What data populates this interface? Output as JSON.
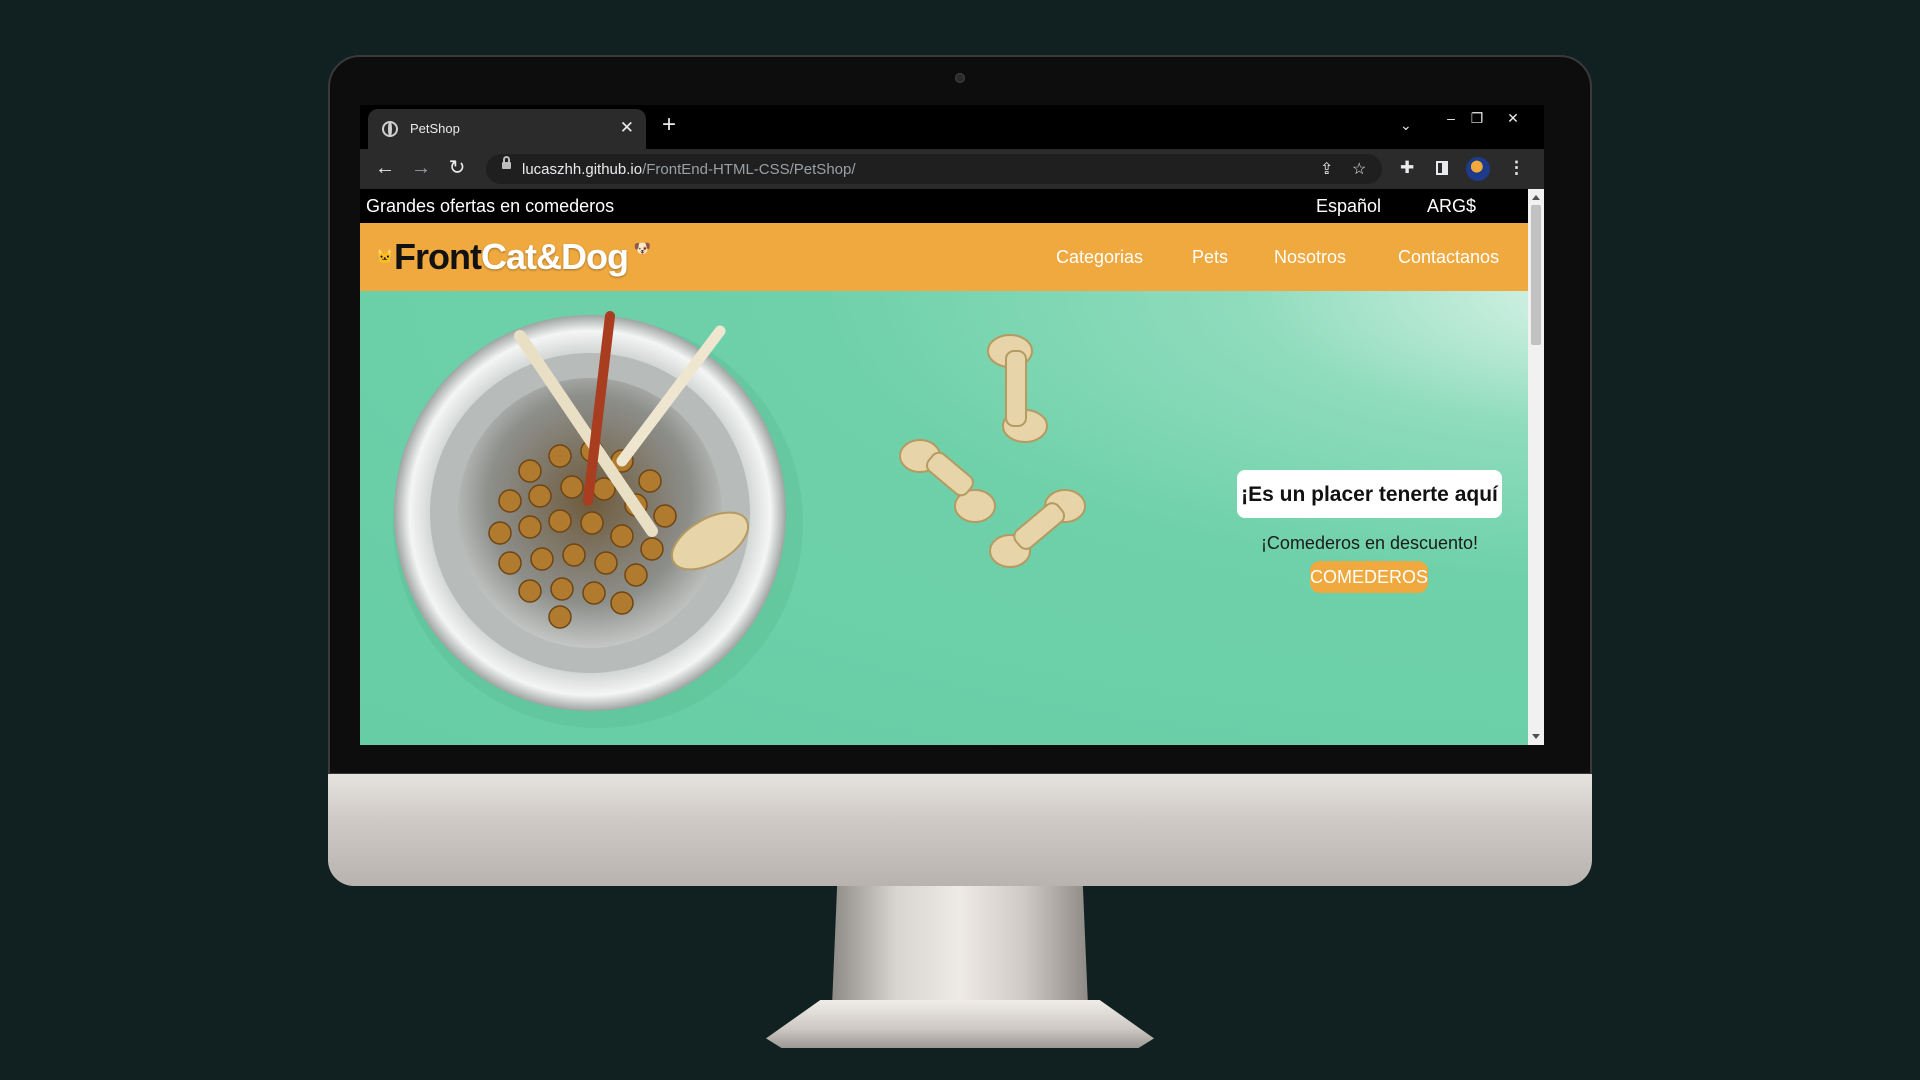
{
  "browser": {
    "tab_title": "PetShop",
    "url_host": "lucaszhh.github.io",
    "url_path": "/FrontEnd-HTML-CSS/PetShop/"
  },
  "site": {
    "promo": "Grandes ofertas en comederos",
    "language": "Español",
    "currency": "ARG$",
    "logo_front": "Front",
    "logo_catdog": "Cat&Dog",
    "nav": [
      "Categorias",
      "Pets",
      "Nosotros",
      "Contactanos"
    ],
    "hero": {
      "greeting": "¡Es un placer tenerte aquí",
      "subtitle": "¡Comederos en descuento!",
      "cta": "COMEDEROS"
    }
  },
  "colors": {
    "brand_orange": "#efa93f",
    "hero_green": "#6ed3ac",
    "background": "#112021"
  }
}
